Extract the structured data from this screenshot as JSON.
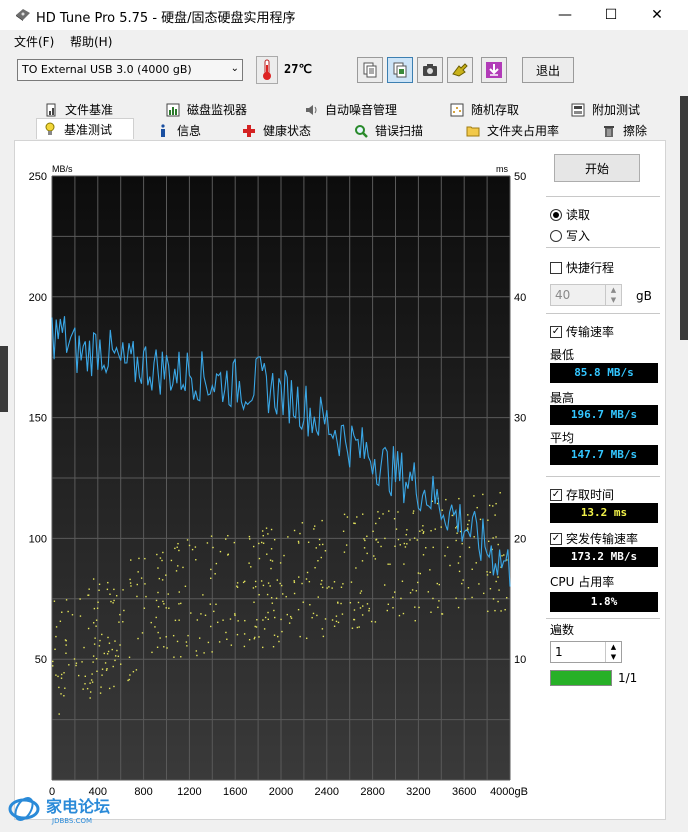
{
  "window": {
    "title": "HD Tune Pro 5.75 - 硬盘/固态硬盘实用程序",
    "minimize": "—",
    "maximize": "☐",
    "close": "✕"
  },
  "menu": {
    "file": "文件(F)",
    "help": "帮助(H)"
  },
  "toolbar": {
    "drive": "TO External USB 3.0 (4000 gB)",
    "temperature": "27℃",
    "exit": "退出",
    "icons": [
      "copy-info-icon",
      "copy-screenshot-icon",
      "camera-icon",
      "options-icon",
      "save-icon"
    ]
  },
  "tabs": {
    "row1": [
      "文件基准",
      "磁盘监视器",
      "自动噪音管理",
      "随机存取",
      "附加测试"
    ],
    "row2": [
      "基准测试",
      "信息",
      "健康状态",
      "错误扫描",
      "文件夹占用率",
      "擦除"
    ]
  },
  "side": {
    "start": "开始",
    "read": "读取",
    "write": "写入",
    "short_stroke": "快捷行程",
    "short_stroke_value": "40",
    "short_stroke_unit": "gB",
    "transfer_rate": "传输速率",
    "min_label": "最低",
    "min_value": "85.8 MB/s",
    "max_label": "最高",
    "max_value": "196.7 MB/s",
    "avg_label": "平均",
    "avg_value": "147.7 MB/s",
    "access_time": "存取时间",
    "access_value": "13.2 ms",
    "burst_rate": "突发传输速率",
    "burst_value": "173.2 MB/s",
    "cpu_label": "CPU 占用率",
    "cpu_value": "1.8%",
    "passes_label": "遍数",
    "passes_value": "1",
    "progress_text": "1/1",
    "progress": 1.0
  },
  "chart_data": {
    "type": "line",
    "y_left_label": "MB/s",
    "y_right_label": "ms",
    "y_left_ticks": [
      "250",
      "200",
      "150",
      "100",
      "50"
    ],
    "y_right_ticks": [
      "50",
      "40",
      "30",
      "20",
      "10"
    ],
    "x_ticks": [
      "0",
      "400",
      "800",
      "1200",
      "1600",
      "2000",
      "2400",
      "2800",
      "3200",
      "3600",
      "4000gB"
    ],
    "ylim_left": [
      0,
      250
    ],
    "ylim_right": [
      0,
      50
    ],
    "xlim": [
      0,
      4000
    ],
    "series": [
      {
        "color": "#3aa7e6",
        "x": [
          0,
          100,
          200,
          300,
          400,
          500,
          600,
          700,
          800,
          900,
          1000,
          1100,
          1200,
          1300,
          1400,
          1500,
          1600,
          1700,
          1800,
          1900,
          2000,
          2100,
          2200,
          2300,
          2400,
          2500,
          2600,
          2700,
          2800,
          2900,
          3000,
          3100,
          3200,
          3300,
          3400,
          3500,
          3600,
          3700,
          3800,
          3900,
          4000
        ],
        "values": [
          185,
          184,
          178,
          176,
          180,
          176,
          172,
          171,
          173,
          170,
          170,
          168,
          169,
          167,
          165,
          165,
          164,
          163,
          165,
          162,
          160,
          158,
          155,
          150,
          148,
          144,
          140,
          136,
          135,
          130,
          127,
          125,
          122,
          118,
          114,
          110,
          106,
          100,
          96,
          92,
          88
        ]
      },
      {
        "color": "#e6e65c",
        "x": [
          0,
          400,
          800,
          1200,
          1600,
          2000,
          2400,
          2800,
          3200,
          3600,
          4000
        ],
        "values": [
          10,
          12,
          14,
          15,
          16,
          16,
          17,
          18,
          18,
          19,
          19
        ]
      }
    ],
    "grid": true,
    "colors": {
      "background": "#000000",
      "grid": "#5a5a5a"
    }
  }
}
